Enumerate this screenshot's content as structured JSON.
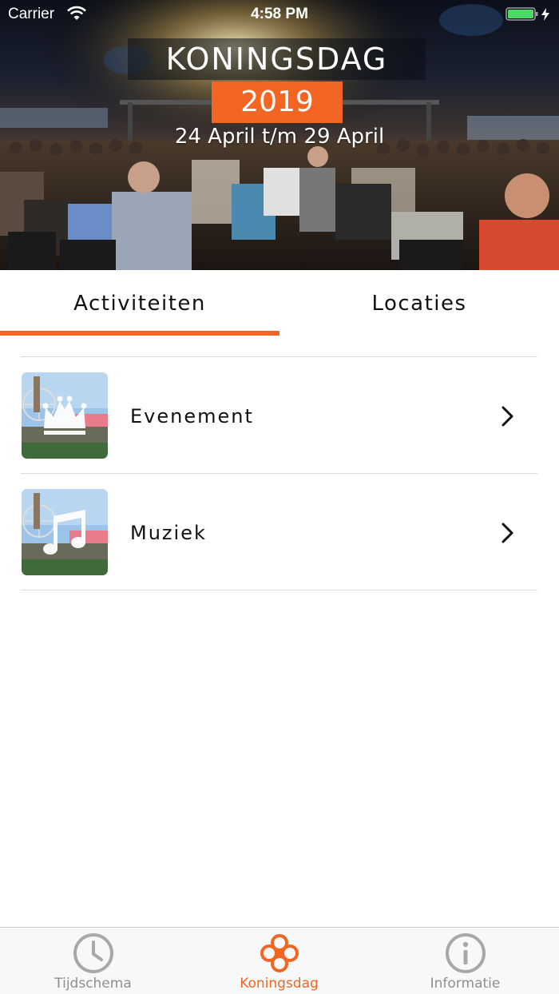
{
  "status_bar": {
    "carrier": "Carrier",
    "time": "4:58 PM",
    "battery_color": "#4cd964"
  },
  "header": {
    "title": "KONINGSDAG",
    "year": "2019",
    "dates": "24 April t/m 29 April",
    "accent_color": "#f26522"
  },
  "tabs": [
    {
      "label": "Activiteiten",
      "active": true
    },
    {
      "label": "Locaties",
      "active": false
    }
  ],
  "activities": [
    {
      "label": "Evenement",
      "icon": "crown-icon"
    },
    {
      "label": "Muziek",
      "icon": "music-note-icon"
    }
  ],
  "tabbar": [
    {
      "label": "Tijdschema",
      "icon": "clock-icon",
      "active": false
    },
    {
      "label": "Koningsdag",
      "icon": "flower-logo-icon",
      "active": true
    },
    {
      "label": "Informatie",
      "icon": "info-icon",
      "active": false
    }
  ]
}
